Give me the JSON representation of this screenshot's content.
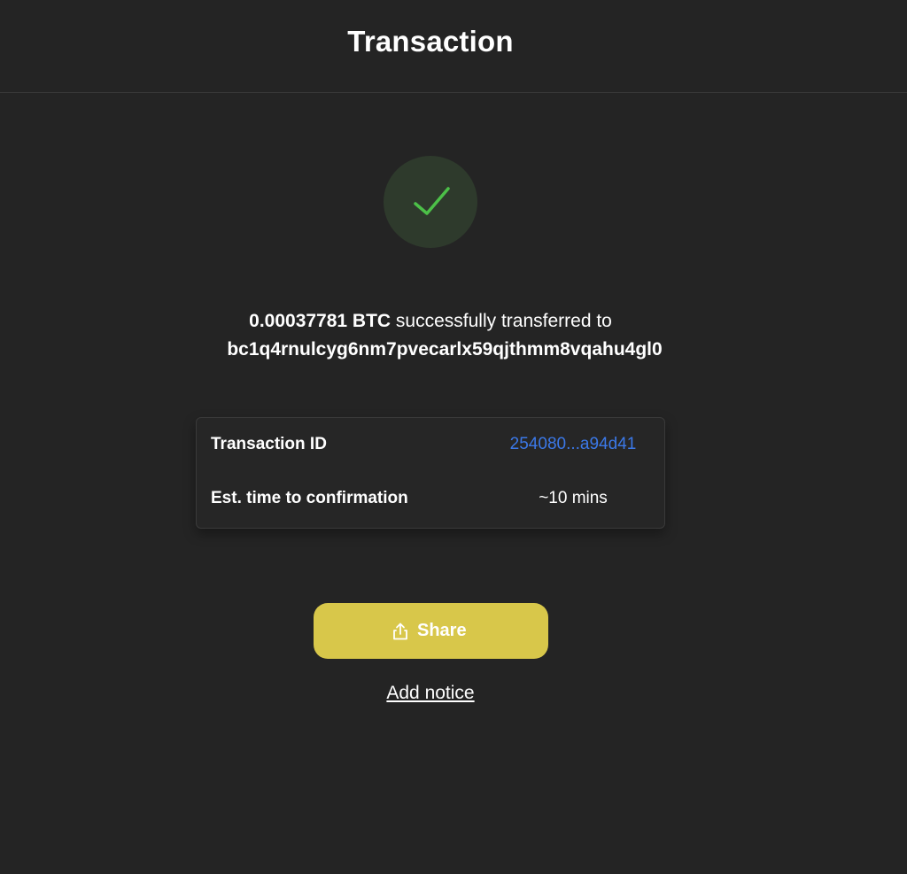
{
  "header": {
    "title": "Transaction"
  },
  "status": {
    "icon": "checkmark-icon",
    "color": "#4cc048"
  },
  "message": {
    "amount": "0.00037781 BTC",
    "text": " successfully transferred to",
    "address": "bc1q4rnulcyg6nm7pvecarlx59qjthmm8vqahu4gl0"
  },
  "details": {
    "transaction_id_label": "Transaction ID",
    "transaction_id_value": "254080...a94d41",
    "eta_label": "Est. time to confirmation",
    "eta_value": "~10 mins"
  },
  "actions": {
    "share_label": "Share",
    "share_icon": "share-icon",
    "share_color": "#d8c74a",
    "add_notice_label": "Add notice"
  }
}
